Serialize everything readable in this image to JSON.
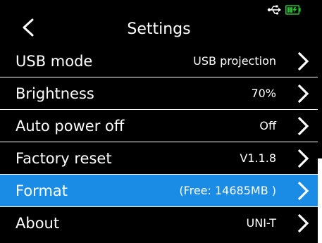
{
  "header": {
    "title": "Settings",
    "back_icon": "chevron-left-icon",
    "status_icons": [
      "usb-icon",
      "battery-charging-icon"
    ],
    "battery_color": "#22c12a"
  },
  "rows": [
    {
      "label": "USB mode",
      "value": "USB projection",
      "icon": "chevron-right-icon"
    },
    {
      "label": "Brightness",
      "value": "70%",
      "icon": "chevron-right-icon"
    },
    {
      "label": "Auto power off",
      "value": "Off",
      "icon": "chevron-right-icon"
    },
    {
      "label": "Factory reset",
      "value": "V1.1.8",
      "icon": "chevron-right-icon"
    },
    {
      "label": "Format",
      "value": "(Free: 14685MB )",
      "icon": "chevron-right-icon",
      "selected": true
    },
    {
      "label": "About",
      "value": "UNI-T",
      "icon": "chevron-right-icon"
    }
  ],
  "colors": {
    "background": "#000000",
    "selected": "#1b8ce6",
    "text": "#ffffff"
  }
}
